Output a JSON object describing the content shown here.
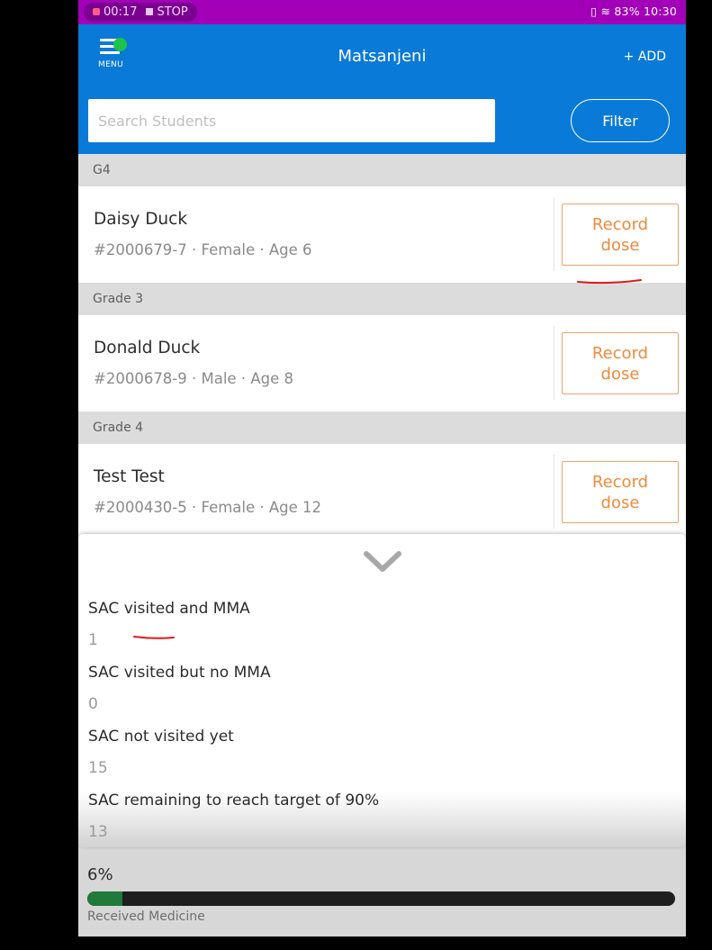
{
  "status_bar": {
    "recording_time": "00:17",
    "stop_label": "STOP",
    "right_text": "83%  10:30"
  },
  "app_bar": {
    "menu_label": "MENU",
    "title": "Matsanjeni",
    "add_label": "+ ADD",
    "search_placeholder": "Search Students",
    "filter_label": "Filter"
  },
  "groups": [
    {
      "header": "G4",
      "student": {
        "name": "Daisy Duck",
        "meta": "#2000679-7 · Female · Age 6",
        "action": "Record dose"
      }
    },
    {
      "header": "Grade 3",
      "student": {
        "name": "Donald Duck",
        "meta": "#2000678-9 · Male · Age 8",
        "action": "Record dose"
      }
    },
    {
      "header": "Grade 4",
      "student": {
        "name": "Test Test",
        "meta": "#2000430-5 · Female · Age 12",
        "action": "Record dose"
      }
    }
  ],
  "summary": {
    "items": [
      {
        "label": "SAC visited and MMA",
        "value": "1"
      },
      {
        "label": "SAC visited but no MMA",
        "value": "0"
      },
      {
        "label": "SAC not visited yet",
        "value": "15"
      },
      {
        "label": "SAC remaining to reach target of 90%",
        "value": "13"
      }
    ]
  },
  "progress": {
    "percent_text": "6%",
    "fraction": 0.06,
    "label": "Received Medicine"
  },
  "colors": {
    "status_bar": "#a100b8",
    "app_bar": "#0a7ad8",
    "accent_orange": "#ee8a3c",
    "progress_fill": "#1f7a3c",
    "menu_dot": "#1ec24a"
  }
}
